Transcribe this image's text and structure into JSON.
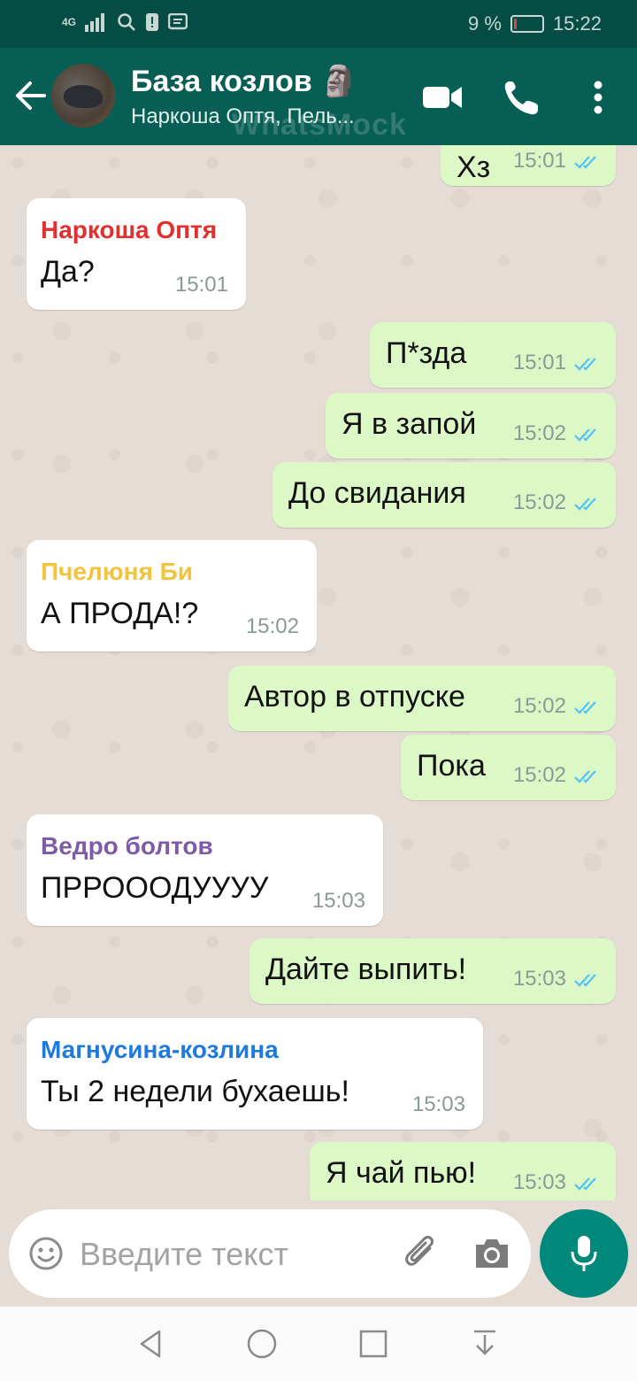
{
  "status_bar": {
    "network": "4G",
    "battery_percent": "9 %",
    "battery_level": 0.09,
    "time": "15:22"
  },
  "header": {
    "title": "База козлов",
    "title_emoji": "🗿",
    "subtitle": "Наркоша Оптя, Пель...",
    "watermark": "WhatsMock",
    "icons": [
      "back-arrow-icon",
      "video-call-icon",
      "phone-icon",
      "more-vert-icon"
    ]
  },
  "messages": [
    {
      "dir": "out",
      "text": "Хз",
      "time": "15:01",
      "read": true
    },
    {
      "dir": "in",
      "sender": "Наркоша Оптя",
      "sender_color": "#e3302f",
      "text": "Да?",
      "time": "15:01"
    },
    {
      "dir": "out",
      "text": "П*зда",
      "time": "15:01",
      "read": true
    },
    {
      "dir": "out",
      "text": "Я в запой",
      "time": "15:02",
      "read": true
    },
    {
      "dir": "out",
      "text": "До свидания",
      "time": "15:02",
      "read": true
    },
    {
      "dir": "in",
      "sender": "Пчелюня Би",
      "sender_color": "#f3c33c",
      "text": "А ПРОДА!?",
      "time": "15:02"
    },
    {
      "dir": "out",
      "text": "Автор в отпуске",
      "time": "15:02",
      "read": true
    },
    {
      "dir": "out",
      "text": "Пока",
      "time": "15:02",
      "read": true
    },
    {
      "dir": "in",
      "sender": "Ведро болтов",
      "sender_color": "#7d5ba6",
      "text": "ПРРОООДУУУУ",
      "time": "15:03"
    },
    {
      "dir": "out",
      "text": "Дайте выпить!",
      "time": "15:03",
      "read": true
    },
    {
      "dir": "in",
      "sender": "Магнусина-козлина",
      "sender_color": "#1f7ae0",
      "text": "Ты 2 недели бухаешь!",
      "time": "15:03"
    },
    {
      "dir": "out",
      "text": "Я чай пью!",
      "time": "15:03",
      "read": true
    }
  ],
  "input": {
    "placeholder": "Введите текст",
    "icons": [
      "emoji-icon",
      "attach-icon",
      "camera-icon",
      "mic-icon"
    ]
  },
  "colors": {
    "header": "#075e54",
    "status_bar": "#054d44",
    "outgoing_bubble": "#dcf8c6",
    "incoming_bubble": "#ffffff",
    "read_ticks": "#4fc3f7",
    "mic_button": "#00897b"
  }
}
